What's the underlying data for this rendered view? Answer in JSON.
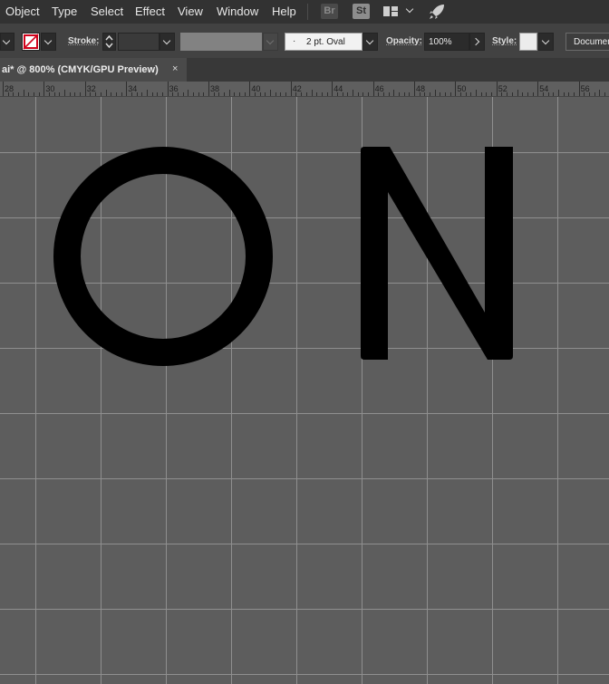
{
  "menu": {
    "items": [
      "Object",
      "Type",
      "Select",
      "Effect",
      "View",
      "Window",
      "Help"
    ],
    "bridge_badge": "Br",
    "stock_badge": "St"
  },
  "control": {
    "stroke_label": "Stroke:",
    "brush_value": "2 pt. Oval",
    "opacity_label": "Opacity:",
    "opacity_value": "100%",
    "style_label": "Style:",
    "document_button": "Document"
  },
  "tab": {
    "title": "ai* @ 800% (CMYK/GPU Preview)",
    "close_glyph": "×"
  },
  "ruler": {
    "labels": [
      "28",
      "30",
      "32",
      "34",
      "36",
      "38",
      "40",
      "42",
      "44",
      "46",
      "48",
      "50",
      "52",
      "54",
      "56"
    ]
  },
  "artwork": {
    "letters": [
      "O",
      "N"
    ],
    "fill_color": "#000000"
  },
  "colors": {
    "canvas": "#5d5d5d",
    "grid": "#8f8f8f",
    "ui_dark": "#323232",
    "stroke_swatch": "#d0021b"
  }
}
